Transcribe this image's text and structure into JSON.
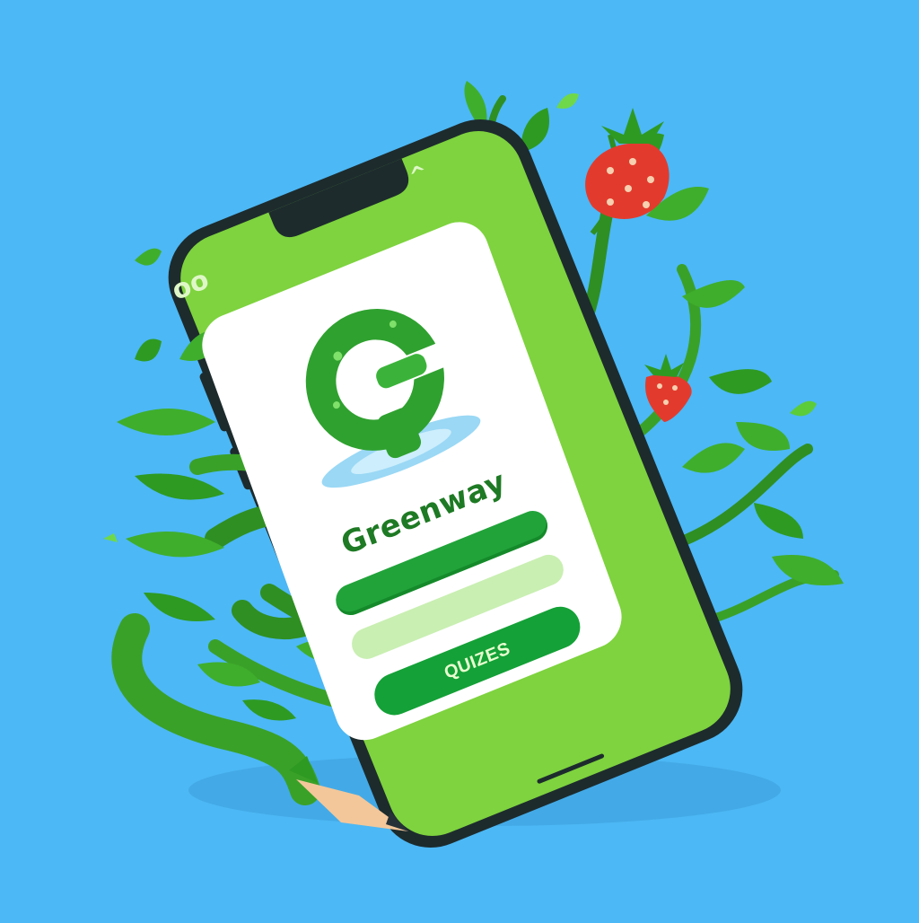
{
  "app": {
    "name": "Greenway",
    "logo_icon": "g-swirl-logo-icon"
  },
  "screen": {
    "status_left_icon": "oo",
    "status_right_icon": "^",
    "fields": [
      {
        "name": "primary-field",
        "state": "filled"
      },
      {
        "name": "secondary-field",
        "state": "empty"
      }
    ],
    "quiz_button_label": "QUIZES"
  },
  "colors": {
    "background": "#4cb8f5",
    "phone_body": "#1d2b2d",
    "screen": "#7ed33e",
    "accent": "#14a137",
    "leaf": "#3ea82a",
    "berry": "#e23b2e"
  }
}
